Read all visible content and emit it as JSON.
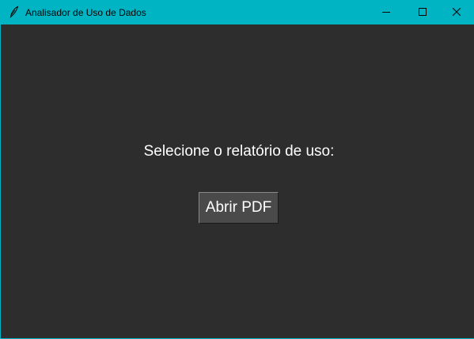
{
  "window": {
    "title": "Analisador de Uso de Dados",
    "icon": "feather-icon",
    "controls": [
      "minimize-icon",
      "maximize-icon",
      "close-icon"
    ]
  },
  "main": {
    "prompt": "Selecione o relatório de uso:",
    "open_button_label": "Abrir PDF"
  },
  "colors": {
    "titlebar": "#00b4c4",
    "background": "#2d2d2d",
    "button": "#4a4a4a",
    "text": "#ffffff"
  }
}
